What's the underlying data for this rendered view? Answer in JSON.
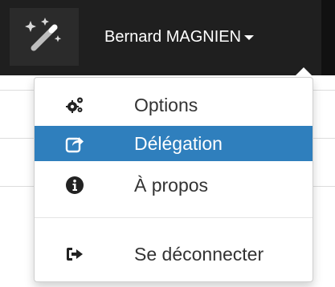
{
  "navbar": {
    "user_name": "Bernard MAGNIEN",
    "magic_icon": "magic-wand-icon"
  },
  "menu": {
    "items": [
      {
        "label": "Options",
        "icon": "gears-icon",
        "active": false
      },
      {
        "label": "Délégation",
        "icon": "share-square-icon",
        "active": true
      },
      {
        "label": "À propos",
        "icon": "info-circle-icon",
        "active": false
      },
      {
        "label": "Se déconnecter",
        "icon": "sign-out-icon",
        "active": false
      }
    ]
  },
  "colors": {
    "navbar_bg": "#1f1f1f",
    "active_item_bg": "#2f7fbd",
    "text": "#333333"
  }
}
